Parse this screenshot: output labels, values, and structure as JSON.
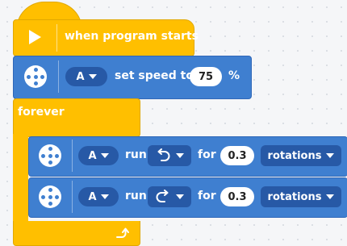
{
  "hat": {
    "label": "when program starts"
  },
  "speed_block": {
    "port": "A",
    "label": "set speed to",
    "value": "75",
    "unit": "%"
  },
  "forever": {
    "label": "forever"
  },
  "run_blocks": [
    {
      "port": "A",
      "run_label": "run",
      "direction": "counterclockwise",
      "for_label": "for",
      "amount": "0.3",
      "unit": "rotations"
    },
    {
      "port": "A",
      "run_label": "run",
      "direction": "clockwise",
      "for_label": "for",
      "amount": "0.3",
      "unit": "rotations"
    }
  ],
  "colors": {
    "yellow": "#ffbf00",
    "blue": "#3f7fd0",
    "dark_blue": "#2759a6"
  }
}
